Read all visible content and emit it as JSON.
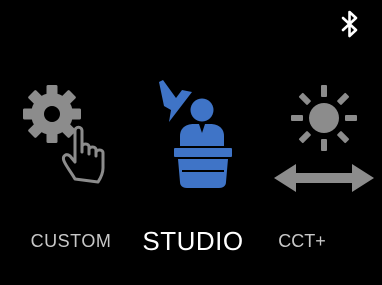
{
  "screen": {
    "background": "#000000"
  },
  "status": {
    "icon": "bluetooth-icon",
    "icon_color": "#ffffff"
  },
  "modes": [
    {
      "label": "CUSTOM",
      "icon": "gear-hand-icon",
      "selected": false,
      "color": "#8c8c8c"
    },
    {
      "label": "STUDIO",
      "icon": "presenter-podium-icon",
      "selected": true,
      "color": "#3f74c7"
    },
    {
      "label": "CCT+",
      "icon": "sun-arrows-icon",
      "selected": false,
      "color": "#8c8c8c"
    }
  ]
}
